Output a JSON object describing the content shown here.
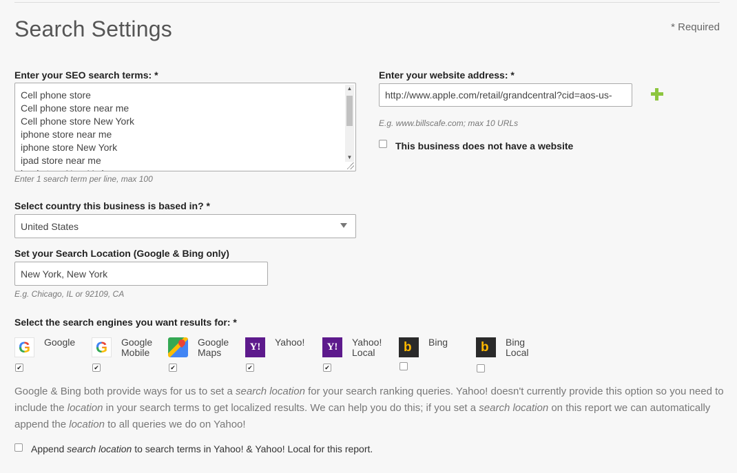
{
  "page": {
    "title": "Search Settings",
    "required_note": "* Required"
  },
  "seo": {
    "label": "Enter your SEO search terms: *",
    "terms": [
      "Cell phone store",
      "Cell phone store near me",
      "Cell phone store New York",
      "iphone store near me",
      "iphone store New York",
      "ipad store near me",
      "ipad store New York"
    ],
    "hint": "Enter 1 search term per line, max 100"
  },
  "website": {
    "label": "Enter your website address: *",
    "value": "http://www.apple.com/retail/grandcentral?cid=aos-us-",
    "hint": "E.g. www.billscafe.com; max 10 URLs",
    "no_website_label": "This business does not have a website",
    "no_website_checked": false,
    "add_icon": "plus-icon"
  },
  "country": {
    "label": "Select country this business is based in? *",
    "selected": "United States"
  },
  "location": {
    "label": "Set your Search Location (Google & Bing only)",
    "value": "New York, New York",
    "hint": "E.g. Chicago, IL or 92109, CA"
  },
  "engines": {
    "label": "Select the search engines you want results for: *",
    "items": [
      {
        "name": "Google",
        "line2": "",
        "icon": "google-icon",
        "checked": true
      },
      {
        "name": "Google",
        "line2": "Mobile",
        "icon": "google-icon",
        "checked": true
      },
      {
        "name": "Google",
        "line2": "Maps",
        "icon": "google-maps-icon",
        "checked": true
      },
      {
        "name": "Yahoo!",
        "line2": "",
        "icon": "yahoo-icon",
        "checked": true
      },
      {
        "name": "Yahoo!",
        "line2": "Local",
        "icon": "yahoo-icon",
        "checked": true
      },
      {
        "name": "Bing",
        "line2": "",
        "icon": "bing-icon",
        "checked": false
      },
      {
        "name": "Bing",
        "line2": "Local",
        "icon": "bing-icon",
        "checked": false
      }
    ]
  },
  "info": {
    "p1": "Google & Bing both provide ways for us to set a ",
    "em1": "search location",
    "p2": " for your search ranking queries. Yahoo! doesn't currently provide this option so you need to include the ",
    "em2": "location",
    "p3": " in your search terms to get localized results. We can help you do this; if you set a ",
    "em3": "search location",
    "p4": " on this report we can automatically append the ",
    "em4": "location",
    "p5": " to all queries we do on Yahoo!"
  },
  "append": {
    "prefix": "Append ",
    "em": "search location",
    "suffix": " to search terms in Yahoo! & Yahoo! Local for this report.",
    "checked": false
  }
}
